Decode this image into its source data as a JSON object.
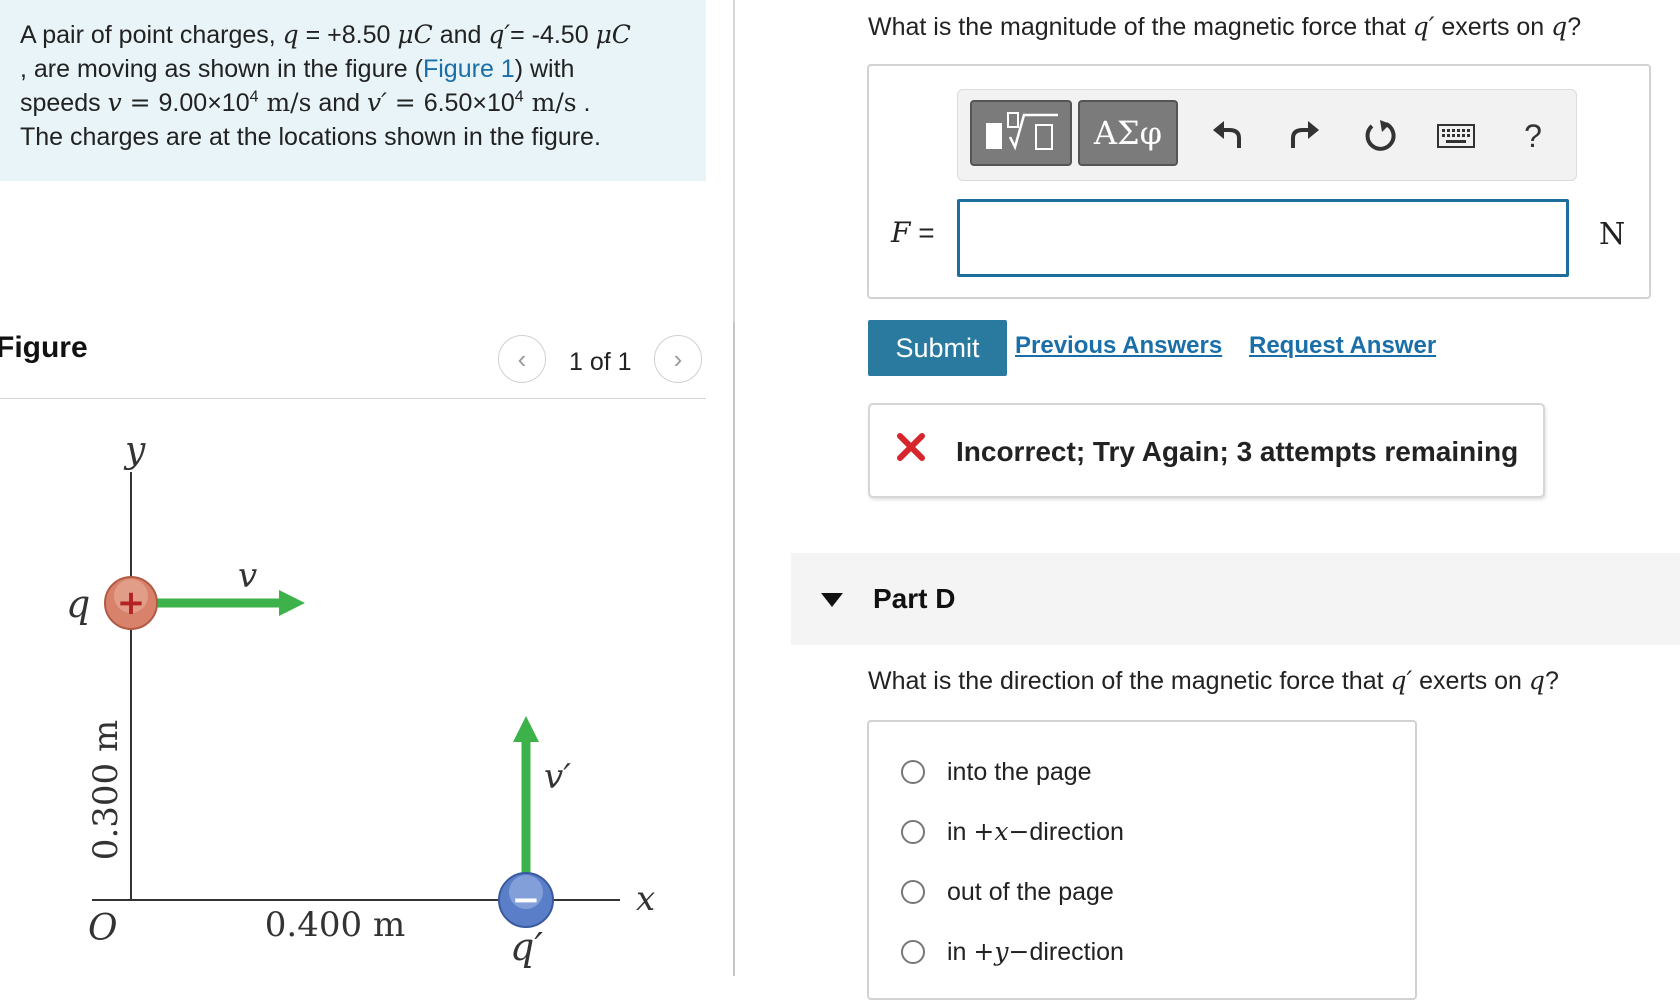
{
  "problem": {
    "intro": "A pair of point charges,",
    "q_sym": "q",
    "q_val": " = +8.50 ",
    "q_unit": "μC",
    "and": " and ",
    "qp_sym": "q′",
    "qp_val": "= -4.50 ",
    "qp_unit": "μC",
    "line2_a": ", are moving as shown in the figure (",
    "figure_link": "Figure 1",
    "line2_b": ") with",
    "speeds": "speeds ",
    "v_sym": "v",
    "v_eq": " = ",
    "v_val": "9.00×10",
    "v_exp": "4",
    "v_unit": " m/s",
    "and2": " and ",
    "vp_sym": "v′",
    "vp_eq": " = ",
    "vp_val": "6.50×10",
    "vp_exp": "4",
    "vp_unit": " m/s",
    "period": " .",
    "line4": "The charges are at the locations shown in the figure."
  },
  "figure_panel": {
    "heading": "Figure",
    "counter": "1 of 1",
    "prev_icon": "chevron-left-icon",
    "next_icon": "chevron-right-icon"
  },
  "diagram": {
    "y_axis": "y",
    "x_axis": "x",
    "origin": "O",
    "q_label": "q",
    "qp_label": "q′",
    "v_label": "v",
    "vp_label": "v′",
    "vertical_dim": "0.300 m",
    "horizontal_dim": "0.400 m",
    "plus_sign": "+",
    "minus_sign": "−",
    "colors": {
      "arrow": "#3eb24a",
      "positive": "#d9826b",
      "negative": "#5a7fc8"
    }
  },
  "part_c": {
    "question_a": "What is the magnitude of the magnetic force that ",
    "question_sym1": "q′",
    "question_b": " exerts on ",
    "question_sym2": "q",
    "question_c": "?",
    "toolbar": {
      "templates_icon": "templates-icon",
      "symbols_label": "ΑΣφ",
      "undo_icon": "undo-icon",
      "redo_icon": "redo-icon",
      "reset_icon": "reset-icon",
      "keyboard_icon": "keyboard-icon",
      "help_label": "?"
    },
    "var_label": "F",
    "equals": " =",
    "input_value": "",
    "unit": "N",
    "submit": "Submit",
    "previous_answers": "Previous Answers",
    "request_answer": "Request Answer",
    "feedback": "Incorrect; Try Again; 3 attempts remaining",
    "feedback_color": "#d6262b"
  },
  "part_d": {
    "title": "Part D",
    "question_a": "What is the direction of the magnetic force that ",
    "question_sym1": "q′",
    "question_b": " exerts on ",
    "question_sym2": "q",
    "question_c": "?",
    "options": [
      {
        "pre": "into the page",
        "sym": "",
        "post": ""
      },
      {
        "pre": "in ",
        "sym": "+x−",
        "post": "direction"
      },
      {
        "pre": "out of the page",
        "sym": "",
        "post": ""
      },
      {
        "pre": "in ",
        "sym": "+y−",
        "post": "direction"
      }
    ]
  }
}
